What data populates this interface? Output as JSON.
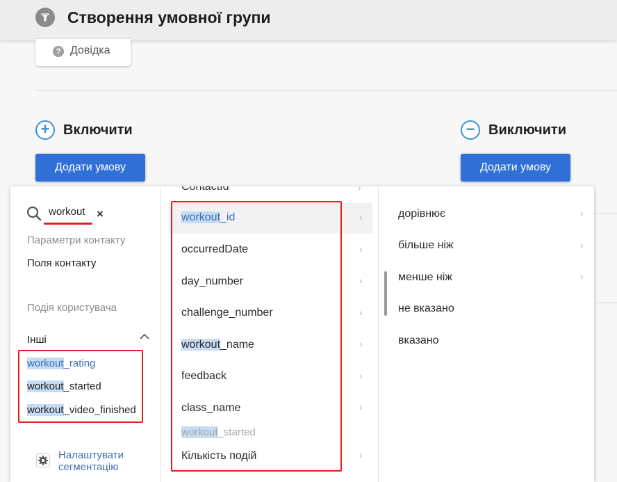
{
  "header": {
    "title": "Створення умовної групи",
    "icon": "funnel-icon"
  },
  "help": {
    "label": "Довідка",
    "icon": "question-icon"
  },
  "include": {
    "title": "Включити",
    "button": "Додати умову",
    "icon": "plus-icon"
  },
  "exclude": {
    "title": "Виключити",
    "button": "Додати умову",
    "icon": "minus-icon"
  },
  "categories": {
    "search": {
      "value": "workout",
      "clear": "×"
    },
    "contact_params": "Параметри контакту",
    "contact_fields": "Поля контакту",
    "user_event": "Подія користувача",
    "others": "Інші",
    "other_items": [
      {
        "match": "workout",
        "rest": "_rating"
      },
      {
        "match": "workout",
        "rest": "_started"
      },
      {
        "match": "workout",
        "rest": "_video_finished"
      }
    ],
    "settings_label": "Налаштувати сегментацію"
  },
  "fields": {
    "partial_top": "ContactId",
    "items": [
      {
        "match": "workout",
        "rest": "_id"
      },
      {
        "match": "",
        "rest": "occurredDate"
      },
      {
        "match": "",
        "rest": "day_number"
      },
      {
        "match": "",
        "rest": "challenge_number"
      },
      {
        "match": "workout",
        "rest": "_name"
      },
      {
        "match": "",
        "rest": "feedback"
      },
      {
        "match": "",
        "rest": "class_name"
      }
    ],
    "disabled_item": {
      "match": "workout",
      "rest": "_started"
    },
    "count_item": "Кількість подій"
  },
  "operators": [
    "дорівнює",
    "більше ніж",
    "менше ніж",
    "не вказано",
    "вказано"
  ],
  "colors": {
    "accent": "#2f6fd6",
    "highlight": "#c5dcf3",
    "annotation": "#e02020"
  }
}
